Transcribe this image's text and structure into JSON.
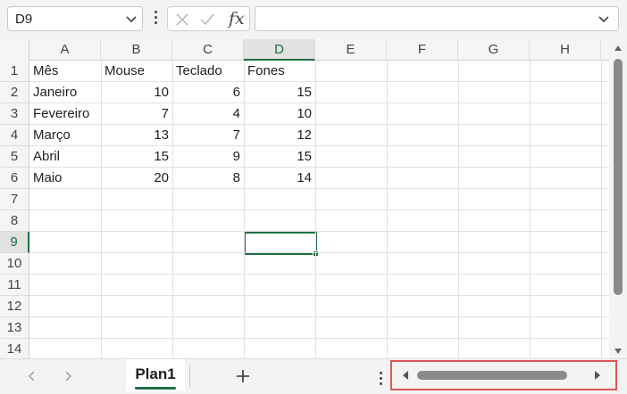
{
  "formula_bar": {
    "name_box": "D9",
    "fx_label": "fx",
    "formula_value": ""
  },
  "columns": [
    "A",
    "B",
    "C",
    "D",
    "E",
    "F",
    "G",
    "H"
  ],
  "selected_column": "D",
  "rows": [
    "1",
    "2",
    "3",
    "4",
    "5",
    "6",
    "7",
    "8",
    "9",
    "10",
    "11",
    "12",
    "13",
    "14"
  ],
  "selected_row": "9",
  "sheet": {
    "header": [
      "Mês",
      "Mouse",
      "Teclado",
      "Fones"
    ],
    "data": [
      [
        "Janeiro",
        "10",
        "6",
        "15"
      ],
      [
        "Fevereiro",
        "7",
        "4",
        "10"
      ],
      [
        "Março",
        "13",
        "7",
        "12"
      ],
      [
        "Abril",
        "15",
        "9",
        "15"
      ],
      [
        "Maio",
        "20",
        "8",
        "14"
      ]
    ]
  },
  "tabs": {
    "active_sheet": "Plan1"
  },
  "colors": {
    "accent": "#1e7145",
    "highlight_box": "#e05555"
  },
  "icons": [
    "chevron-down-icon",
    "more-options-icon",
    "cancel-icon",
    "enter-icon",
    "function-icon",
    "scroll-up-icon",
    "scroll-down-icon",
    "previous-sheet-icon",
    "next-sheet-icon",
    "add-sheet-icon",
    "scroll-left-icon",
    "scroll-right-icon"
  ]
}
